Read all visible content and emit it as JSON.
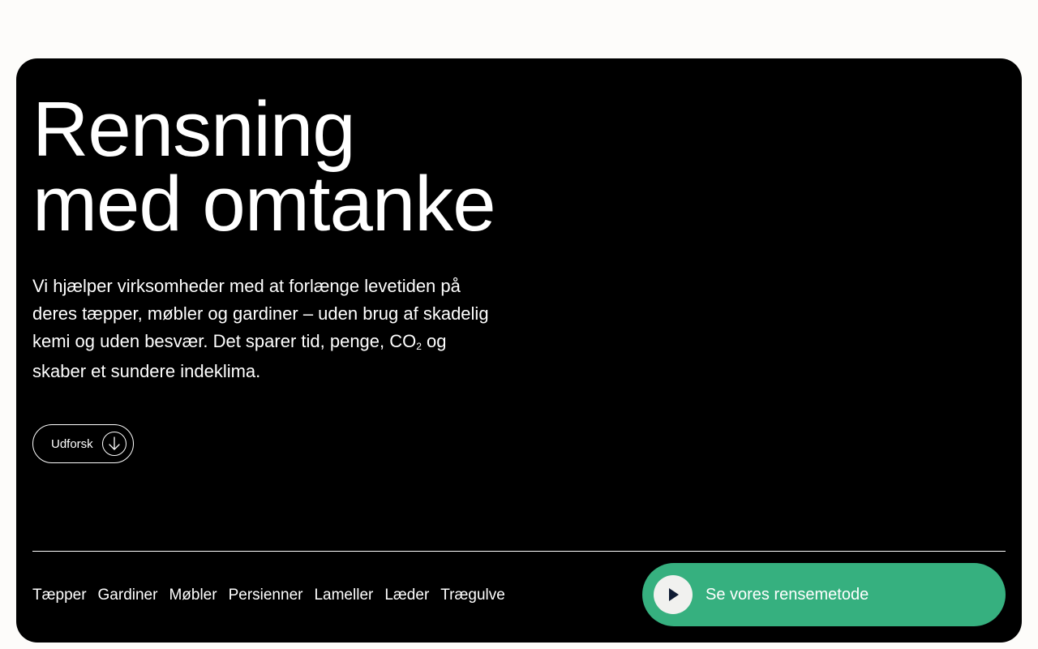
{
  "hero": {
    "headline_line1": "Rensning",
    "headline_line2": "med omtanke",
    "lead_before_sub": "Vi hjælper virksomheder med at forlænge levetiden på deres tæpper, møbler og gardiner – uden brug af skadelig kemi og uden besvær. Det sparer tid, penge, CO",
    "lead_sub": "2",
    "lead_after_sub": " og skaber et sundere indeklima.",
    "explore_label": "Udforsk",
    "explore_icon": "arrow-down-icon"
  },
  "categories": [
    {
      "label": "Tæpper"
    },
    {
      "label": "Gardiner"
    },
    {
      "label": "Møbler"
    },
    {
      "label": "Persienner"
    },
    {
      "label": "Lameller"
    },
    {
      "label": "Læder"
    },
    {
      "label": "Trægulve"
    }
  ],
  "method_button": {
    "label": "Se vores rensemetode",
    "icon": "play-icon",
    "color": "#36b07f"
  },
  "colors": {
    "page_background": "#fdfcfa",
    "hero_background": "#000000",
    "text": "#ffffff",
    "accent": "#36b07f",
    "play_glyph": "#0f1b33"
  }
}
